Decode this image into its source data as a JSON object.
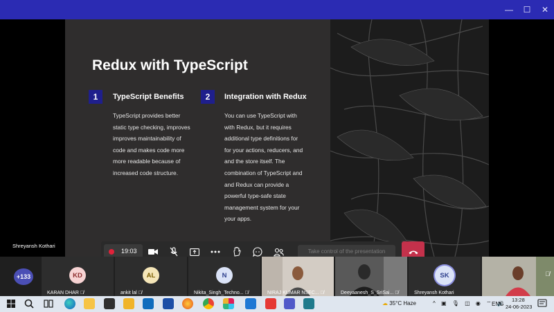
{
  "window": {
    "controls": {
      "minimize": "—",
      "maximize": "☐",
      "close": "✕"
    }
  },
  "slide": {
    "title": "Redux with TypeScript",
    "sections": [
      {
        "number": "1",
        "title": "TypeScript Benefits",
        "lines": [
          "TypeScript provides better",
          "static type checking, improves",
          "improves maintainability of",
          "code and makes code more",
          "more readable because of",
          "increased code structure."
        ]
      },
      {
        "number": "2",
        "title": "Integration with Redux",
        "lines": [
          "You can use TypeScript with",
          "with Redux, but it requires",
          "additional type definitions for",
          "for your actions, reducers, and",
          "and the store itself. The",
          "combination of TypeScript and",
          "and Redux can provide a",
          "powerful type-safe state",
          "management system for your",
          "your apps."
        ]
      }
    ]
  },
  "presenter": {
    "name": "Shreyansh Kothari"
  },
  "meeting_controls": {
    "recording_time": "19:03",
    "take_control_label": "Take control of the presentation",
    "icons": [
      "record-icon",
      "camera-icon",
      "mic-off-icon",
      "share-icon",
      "more-icon",
      "raise-hand-icon",
      "chat-icon",
      "people-icon",
      "hang-up-icon"
    ],
    "hangup_color": "#c4314b"
  },
  "gallery": {
    "overflow_count": "+133",
    "participants": [
      {
        "name": "KARAN DHAR",
        "initials": "KD",
        "avatar_bg": "#f7d3d3",
        "avatar_fg": "#8c2d2d",
        "video": false
      },
      {
        "name": "ankit lal",
        "initials": "AL",
        "avatar_bg": "#f5e6b8",
        "avatar_fg": "#7a5c00",
        "video": false
      },
      {
        "name": "Nikita_Singh_Techno...",
        "initials": "N",
        "avatar_bg": "#dbe3f7",
        "avatar_fg": "#2d3f8c",
        "video": false
      },
      {
        "name": "NIRAJ KUMAR NSEC...",
        "initials": "",
        "video": true
      },
      {
        "name": "Deeyaanesh_S_SriSai...",
        "initials": "",
        "video": true
      },
      {
        "name": "Shreyansh Kothari",
        "initials": "SK",
        "avatar_bg": "#dbe3f7",
        "avatar_fg": "#2d3f8c",
        "video": false
      },
      {
        "name": "",
        "initials": "",
        "video": true
      }
    ]
  },
  "taskbar": {
    "weather": "35°C Haze",
    "language": "ENG",
    "time": "13:28",
    "date": "24-06-2023",
    "pinned_apps": [
      "file-explorer-icon",
      "task-view-icon",
      "edge-icon",
      "folder-icon",
      "mail-icon",
      "store-icon",
      "calculator-icon",
      "firefox-icon",
      "chrome-icon",
      "slack-icon",
      "settings-icon",
      "vscode-icon",
      "anydesk-icon",
      "teams-icon",
      "photos-icon",
      "windows-media-icon"
    ]
  }
}
